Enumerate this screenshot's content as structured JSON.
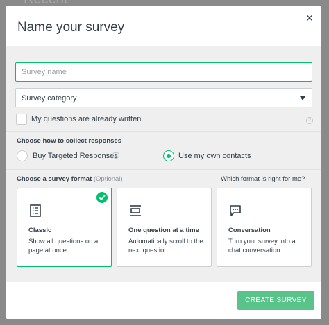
{
  "background": {
    "text": "Recent"
  },
  "modal": {
    "title": "Name your survey",
    "close_label": "×"
  },
  "form": {
    "name_placeholder": "Survey name",
    "category_value": "Survey category",
    "written_label": "My questions are already written.",
    "written_checked": false
  },
  "collect": {
    "heading": "Choose how to collect responses",
    "options": [
      {
        "label": "Buy Targeted Responses",
        "selected": false
      },
      {
        "label": "Use my own contacts",
        "selected": true
      }
    ]
  },
  "format": {
    "heading": "Choose a survey format",
    "optional": "(Optional)",
    "help_link": "Which format is right for me?",
    "cards": [
      {
        "title": "Classic",
        "description": "Show all questions on a page at once",
        "icon": "list-icon",
        "selected": true
      },
      {
        "title": "One question at a time",
        "description": "Automatically scroll to the next question",
        "icon": "single-question-icon",
        "selected": false
      },
      {
        "title": "Conversation",
        "description": "Turn your survey into a chat conversation",
        "icon": "chat-bubble-icon",
        "selected": false
      }
    ]
  },
  "footer": {
    "create_label": "CREATE SURVEY"
  },
  "colors": {
    "accent": "#00bf6f",
    "button": "#59c38a",
    "body_bg": "#efefef",
    "text": "#333e48"
  }
}
